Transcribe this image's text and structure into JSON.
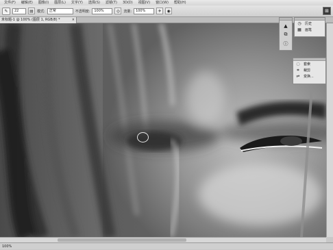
{
  "menu": [
    "文件(F)",
    "编辑(E)",
    "图像(I)",
    "图层(L)",
    "文字(Y)",
    "选择(S)",
    "滤镜(T)",
    "3D(D)",
    "视图(V)",
    "窗口(W)",
    "帮助(H)"
  ],
  "options": {
    "brush_size": "22",
    "mode_label": "模式:",
    "mode_value": "正常",
    "opacity_label": "不透明度:",
    "opacity_value": "100%",
    "flow_label": "流量:",
    "flow_value": "100%"
  },
  "document": {
    "tab_title": "未标题-1 @ 100% (图层 1, RGB/8) *",
    "close": "×"
  },
  "status": {
    "zoom": "100%"
  },
  "panels": {
    "history_items": [
      {
        "icon": "clock-icon",
        "glyph": "◷",
        "label": "历史"
      },
      {
        "icon": "brush-preset-icon",
        "glyph": "▦",
        "label": "画笔"
      }
    ],
    "adjust_items": [
      {
        "icon": "lasso-icon",
        "glyph": "◌",
        "label": "套索"
      },
      {
        "icon": "crop-icon",
        "glyph": "⌗",
        "label": "裁剪"
      },
      {
        "icon": "transform-icon",
        "glyph": "⇌",
        "label": "变换..."
      }
    ]
  },
  "colors": {
    "chrome": "#d6d6d6",
    "canvas_dark": "#3c3c3c",
    "canvas_light": "#dcdcdc"
  }
}
